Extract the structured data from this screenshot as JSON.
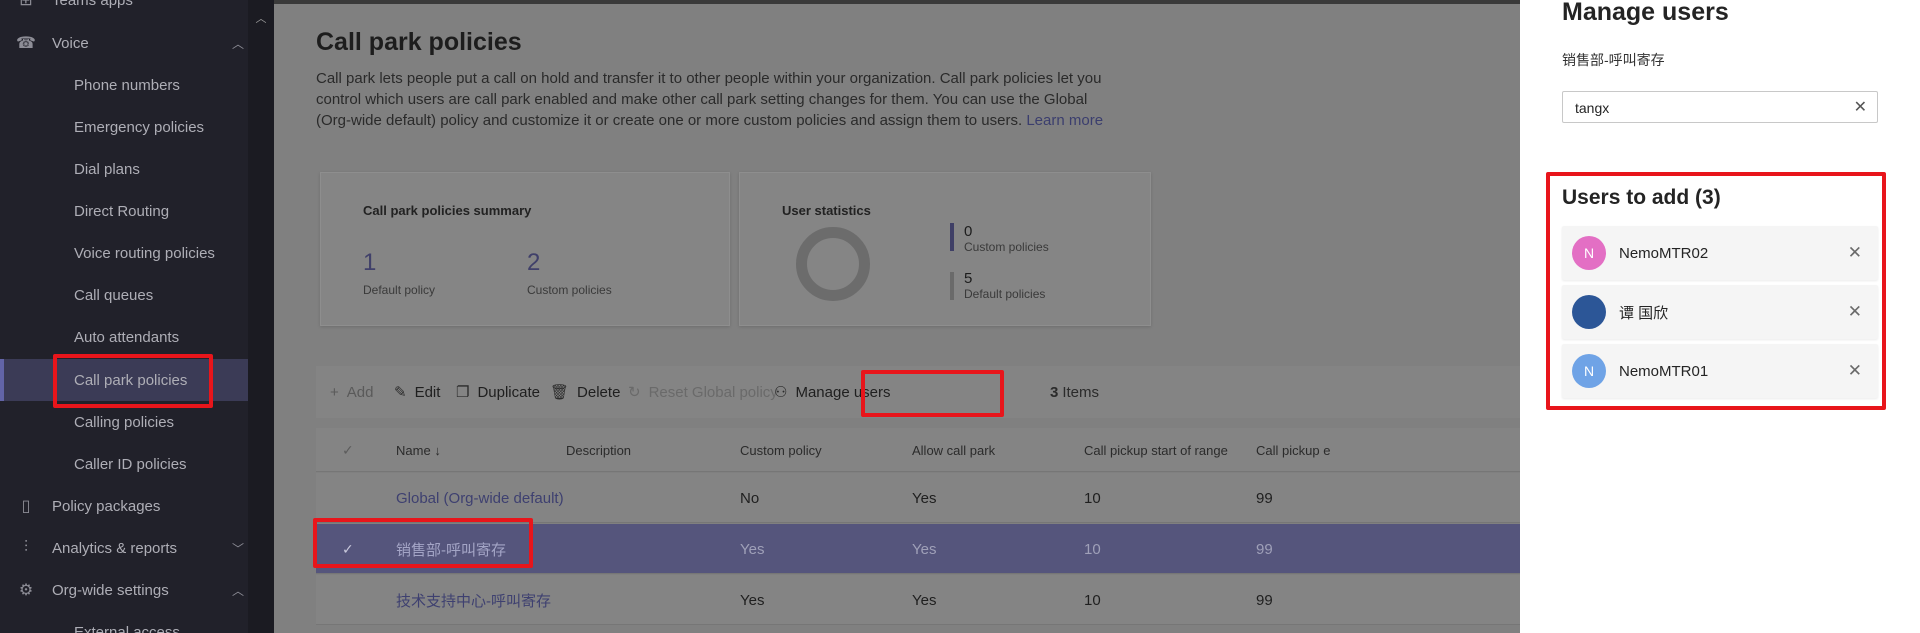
{
  "sidebar": {
    "top_item": {
      "label": "Teams apps",
      "icon": "apps-icon"
    },
    "voice": {
      "label": "Voice",
      "icon": "phone-icon"
    },
    "sub_items": [
      {
        "label": "Phone numbers"
      },
      {
        "label": "Emergency policies"
      },
      {
        "label": "Dial plans"
      },
      {
        "label": "Direct Routing"
      },
      {
        "label": "Voice routing policies"
      },
      {
        "label": "Call queues"
      },
      {
        "label": "Auto attendants"
      },
      {
        "label": "Call park policies",
        "active": true
      },
      {
        "label": "Calling policies"
      },
      {
        "label": "Caller ID policies"
      }
    ],
    "policy_packages": {
      "label": "Policy packages",
      "icon": "package-icon"
    },
    "analytics": {
      "label": "Analytics & reports",
      "icon": "analytics-icon"
    },
    "org_wide": {
      "label": "Org-wide settings",
      "icon": "gear-icon"
    },
    "external_access": {
      "label": "External access"
    }
  },
  "page": {
    "title": "Call park policies",
    "description": "Call park lets people put a call on hold and transfer it to other people within your organization. Call park policies let you control which users are call park enabled and make other call park setting changes for them. You can use the Global (Org-wide default) policy and customize it or create one or more custom policies and assign them to users.",
    "learn_more": "Learn more"
  },
  "summary_card": {
    "title": "Call park policies summary",
    "default_value": "1",
    "default_label": "Default policy",
    "custom_value": "2",
    "custom_label": "Custom policies"
  },
  "user_stats": {
    "title": "User statistics",
    "custom_value": "0",
    "custom_label": "Custom policies",
    "default_value": "5",
    "default_label": "Default policies",
    "colors": {
      "custom": "#3f3f66",
      "default": "#6a6a6a"
    }
  },
  "toolbar": {
    "add": "Add",
    "edit": "Edit",
    "duplicate": "Duplicate",
    "delete": "Delete",
    "reset": "Reset Global policy",
    "manage_users": "Manage users",
    "items_count": "3",
    "items_label": "Items"
  },
  "table": {
    "columns": [
      "Name",
      "Description",
      "Custom policy",
      "Allow call park",
      "Call pickup start of range",
      "Call pickup e"
    ],
    "sort_indicator": "↓",
    "rows": [
      {
        "name": "Global (Org-wide default)",
        "description": "",
        "custom": "No",
        "allow": "Yes",
        "start": "10",
        "end": "99",
        "selected": false
      },
      {
        "name": "销售部-呼叫寄存",
        "description": "",
        "custom": "Yes",
        "allow": "Yes",
        "start": "10",
        "end": "99",
        "selected": true
      },
      {
        "name": "技术支持中心-呼叫寄存",
        "description": "",
        "custom": "Yes",
        "allow": "Yes",
        "start": "10",
        "end": "99",
        "selected": false
      }
    ]
  },
  "panel": {
    "title": "Manage users",
    "subtitle": "销售部-呼叫寄存",
    "search_value": "tangx",
    "users_heading": "Users to add (3)",
    "users": [
      {
        "initial": "N",
        "name": "NemoMTR02",
        "color": "#e36fc4"
      },
      {
        "initial": "",
        "name": "谭 国欣",
        "color": "#2c5697"
      },
      {
        "initial": "N",
        "name": "NemoMTR01",
        "color": "#6fa3e6"
      }
    ]
  },
  "colors": {
    "highlight": "#e8151b",
    "accent": "#6264a7",
    "sidebar_bg": "#21212a"
  }
}
